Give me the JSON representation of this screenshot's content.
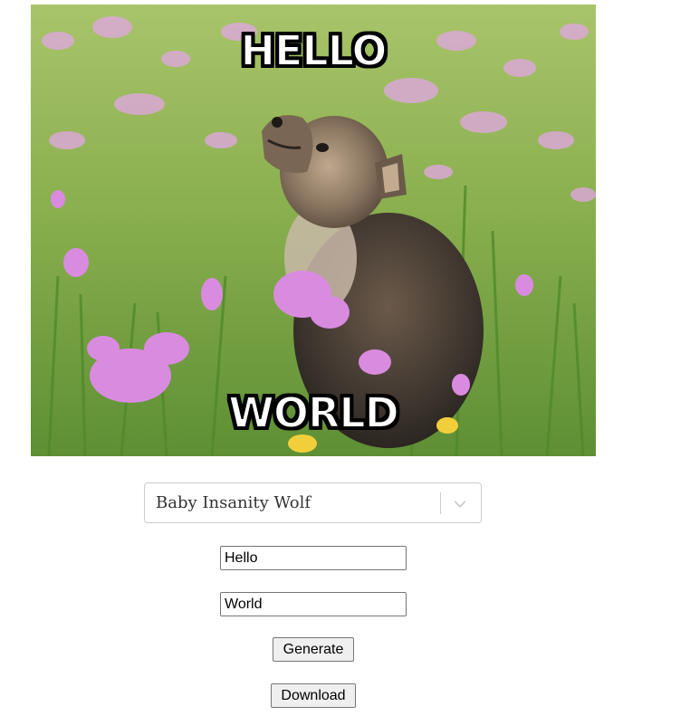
{
  "meme": {
    "top_text": "HELLO",
    "bottom_text": "WORLD",
    "image_description_icon": "baby-wolf-howling-in-flower-meadow"
  },
  "template_select": {
    "selected": "Baby Insanity Wolf"
  },
  "inputs": {
    "top_text_value": "Hello",
    "bottom_text_value": "World"
  },
  "buttons": {
    "generate_label": "Generate",
    "download_label": "Download"
  },
  "colors": {
    "grass": "#7faa4a",
    "flower": "#d98be0",
    "button_bg": "#efefef",
    "select_border": "#cccccc"
  }
}
